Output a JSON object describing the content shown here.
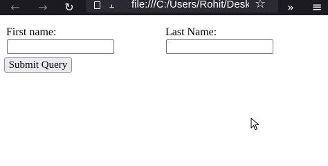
{
  "browser": {
    "address_bar_text": "file:///C:/Users/Rohit/Desk",
    "icons": {
      "back": "back-arrow-icon",
      "forward": "forward-arrow-icon",
      "reload": "reload-icon",
      "page": "page-icon",
      "permissions": "permissions-icon",
      "bookmark": "star-icon",
      "overflow": "chevron-double-right-icon",
      "menu": "hamburger-menu-icon"
    }
  },
  "form": {
    "first_name_label": "First name:",
    "last_name_label": "Last Name:",
    "first_name_value": "",
    "last_name_value": "",
    "submit_label": "Submit Query"
  }
}
